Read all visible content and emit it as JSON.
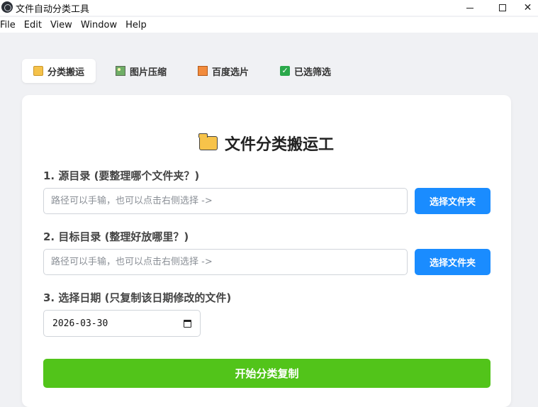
{
  "window": {
    "title": "文件自动分类工具"
  },
  "menu": [
    "File",
    "Edit",
    "View",
    "Window",
    "Help"
  ],
  "tabs": [
    {
      "label": "分类搬运",
      "icon": "folder-icon",
      "active": true
    },
    {
      "label": "图片压缩",
      "icon": "image-icon",
      "active": false
    },
    {
      "label": "百度选片",
      "icon": "book-icon",
      "active": false
    },
    {
      "label": "已选筛选",
      "icon": "checkbox-icon",
      "active": false
    }
  ],
  "card": {
    "title": "文件分类搬运工",
    "source": {
      "label": "1. 源目录 (要整理哪个文件夹？)",
      "placeholder": "路径可以手输，也可以点击右侧选择 ->",
      "button": "选择文件夹"
    },
    "target": {
      "label": "2. 目标目录 (整理好放哪里？)",
      "placeholder": "路径可以手输，也可以点击右侧选择 ->",
      "button": "选择文件夹"
    },
    "date": {
      "label": "3. 选择日期 (只复制该日期修改的文件)",
      "value": "2026-03-30"
    },
    "start_button": "开始分类复制"
  },
  "colors": {
    "accent_blue": "#1a8cff",
    "start_green": "#52c41a"
  }
}
